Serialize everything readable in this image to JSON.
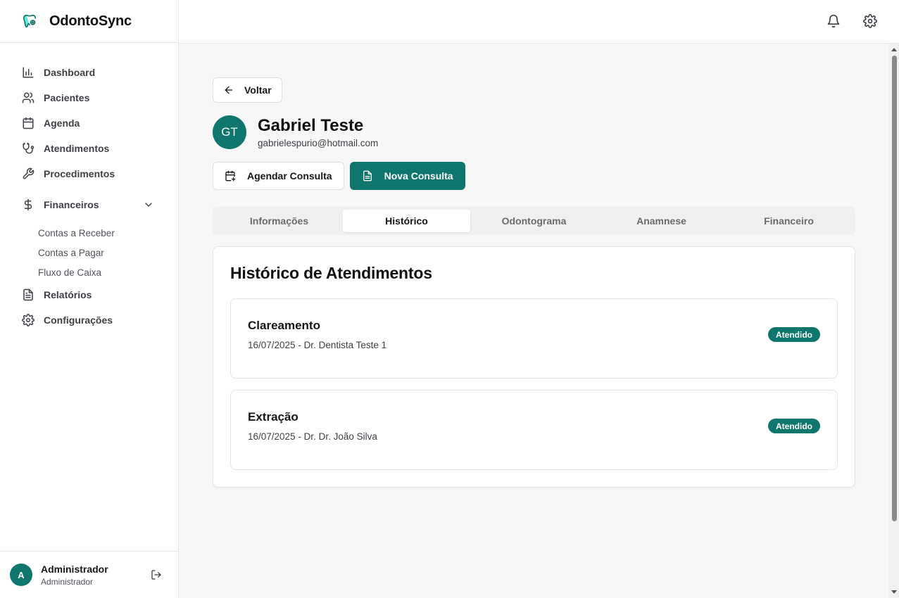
{
  "app": {
    "name": "OdontoSync",
    "accent_color": "#0f766e"
  },
  "sidebar": {
    "items": [
      {
        "label": "Dashboard",
        "icon": "bar-chart-icon"
      },
      {
        "label": "Pacientes",
        "icon": "users-icon"
      },
      {
        "label": "Agenda",
        "icon": "calendar-icon"
      },
      {
        "label": "Atendimentos",
        "icon": "stethoscope-icon"
      },
      {
        "label": "Procedimentos",
        "icon": "wrench-icon"
      }
    ],
    "financeiros": {
      "label": "Financeiros",
      "icon": "dollar-icon",
      "expanded": true,
      "sub_items": [
        "Contas a Receber",
        "Contas a Pagar",
        "Fluxo de Caixa"
      ]
    },
    "items_after": [
      {
        "label": "Relatórios",
        "icon": "file-text-icon"
      },
      {
        "label": "Configurações",
        "icon": "gear-icon"
      }
    ],
    "user": {
      "initial": "A",
      "name": "Administrador",
      "role": "Administrador"
    }
  },
  "topbar": {
    "icons": [
      "bell-icon",
      "settings-icon"
    ]
  },
  "main": {
    "back_label": "Voltar",
    "patient": {
      "initials": "GT",
      "name": "Gabriel Teste",
      "email": "gabrielespurio@hotmail.com"
    },
    "actions": {
      "schedule_label": "Agendar Consulta",
      "new_label": "Nova Consulta"
    },
    "tabs": [
      "Informações",
      "Histórico",
      "Odontograma",
      "Anamnese",
      "Financeiro"
    ],
    "active_tab": "Histórico",
    "history": {
      "title": "Histórico de Atendimentos",
      "records": [
        {
          "procedure": "Clareamento",
          "detail": "16/07/2025 - Dr. Dentista Teste 1",
          "status": "Atendido"
        },
        {
          "procedure": "Extração",
          "detail": "16/07/2025 - Dr. Dr. João Silva",
          "status": "Atendido"
        }
      ]
    }
  }
}
